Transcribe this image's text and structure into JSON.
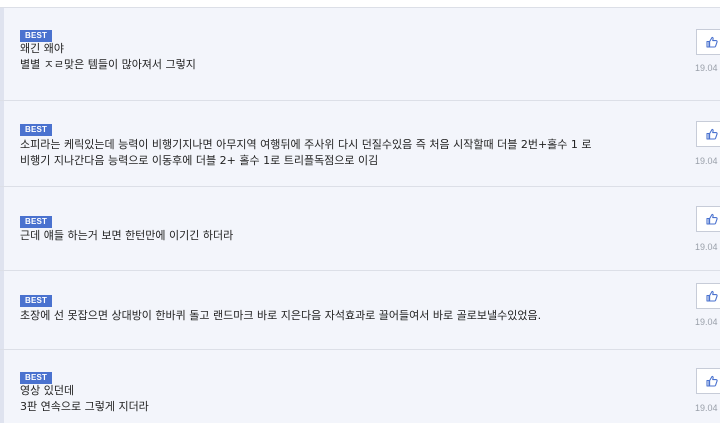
{
  "comments": [
    {
      "badge": "BEST",
      "lines": [
        "왜긴 왜야",
        "별별 ㅈㄹ맞은 템들이 많아져서 그렇지"
      ],
      "date": "19.04",
      "like_icon": "thumbs-up-icon"
    },
    {
      "badge": "BEST",
      "lines": [
        "소피라는 케릭있는데 능력이 비행기지나면 아무지역 여행뒤에 주사위 다시 던질수있음 즉 처음 시작할때 더블 2번+홀수 1 로",
        "비행기 지나간다음 능력으로 이동후에 더블 2+ 홀수 1로 트리플독점으로 이김"
      ],
      "date": "19.04",
      "like_icon": "thumbs-up-icon"
    },
    {
      "badge": "BEST",
      "lines": [
        "근데 얘들 하는거 보면 한턴만에 이기긴 하더라"
      ],
      "date": "19.04",
      "like_icon": "thumbs-up-icon"
    },
    {
      "badge": "BEST",
      "lines": [
        "초장에 선 못잡으면 상대방이 한바퀴 돌고 랜드마크 바로 지은다음 자석효과로 끌어들여서 바로 골로보낼수있었음."
      ],
      "date": "19.04",
      "like_icon": "thumbs-up-icon"
    },
    {
      "badge": "BEST",
      "lines": [
        "영상 있던데",
        "3판 연속으로 그렇게 지더라"
      ],
      "date": "19.04",
      "like_icon": "thumbs-up-icon"
    }
  ]
}
